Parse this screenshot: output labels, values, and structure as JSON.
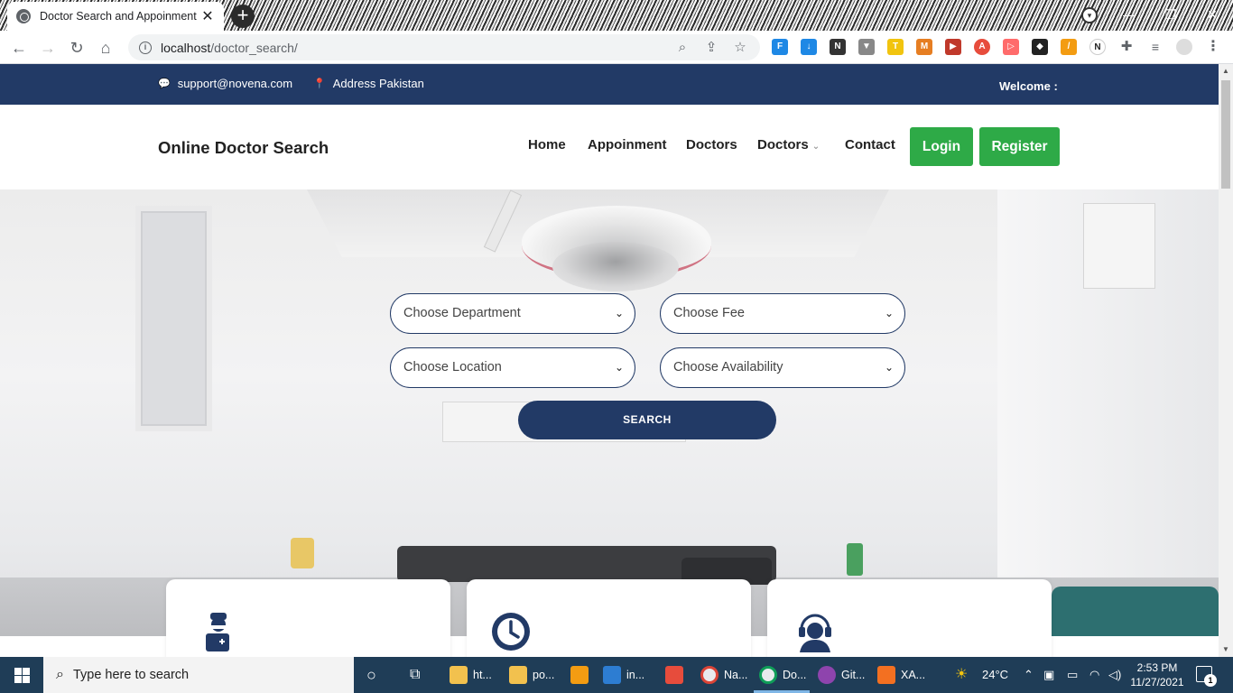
{
  "browser": {
    "tab_title": "Doctor Search and Appoinment",
    "tab_close": "✕",
    "new_tab": "+",
    "url_host": "localhost",
    "url_path": "/doctor_search/",
    "back": "←",
    "forward": "→",
    "reload": "↻",
    "home": "⌂",
    "minimize": "—",
    "maximize": "❐",
    "close": "✕"
  },
  "topbar": {
    "email": "support@novena.com",
    "address": "Address Pakistan",
    "welcome": "Welcome :",
    "email_icon": "💬",
    "address_icon": "📍"
  },
  "navbar": {
    "brand": "Online Doctor Search",
    "links": [
      "Home",
      "Appoinment",
      "Doctors",
      "Doctors",
      "Contact"
    ],
    "login": "Login",
    "register": "Register"
  },
  "search_form": {
    "department": "Choose Department",
    "fee": "Choose Fee",
    "location": "Choose Location",
    "availability": "Choose Availability",
    "submit": "SEARCH"
  },
  "cards": [
    {
      "icon": "doctor-icon"
    },
    {
      "icon": "clock-icon"
    },
    {
      "icon": "support-agent-icon"
    }
  ],
  "taskbar": {
    "search_placeholder": "Type here to search",
    "apps": [
      {
        "label": "ht...",
        "color": "#f2c14e"
      },
      {
        "label": "po...",
        "color": "#f2c14e"
      },
      {
        "label": "",
        "color": "#f39c12"
      },
      {
        "label": "in...",
        "color": "#2d7dd2"
      },
      {
        "label": "",
        "color": "#e74c3c"
      },
      {
        "label": "Na...",
        "color": "#e8eaed"
      },
      {
        "label": "Do...",
        "color": "#e8eaed"
      },
      {
        "label": "Git...",
        "color": "#8e44ad"
      },
      {
        "label": "XA...",
        "color": "#f37021"
      }
    ],
    "temperature": "24°C",
    "time": "2:53 PM",
    "date": "11/27/2021",
    "notification_count": "1"
  },
  "colors": {
    "primary": "#223a66",
    "accent_green": "#2eaa47"
  }
}
